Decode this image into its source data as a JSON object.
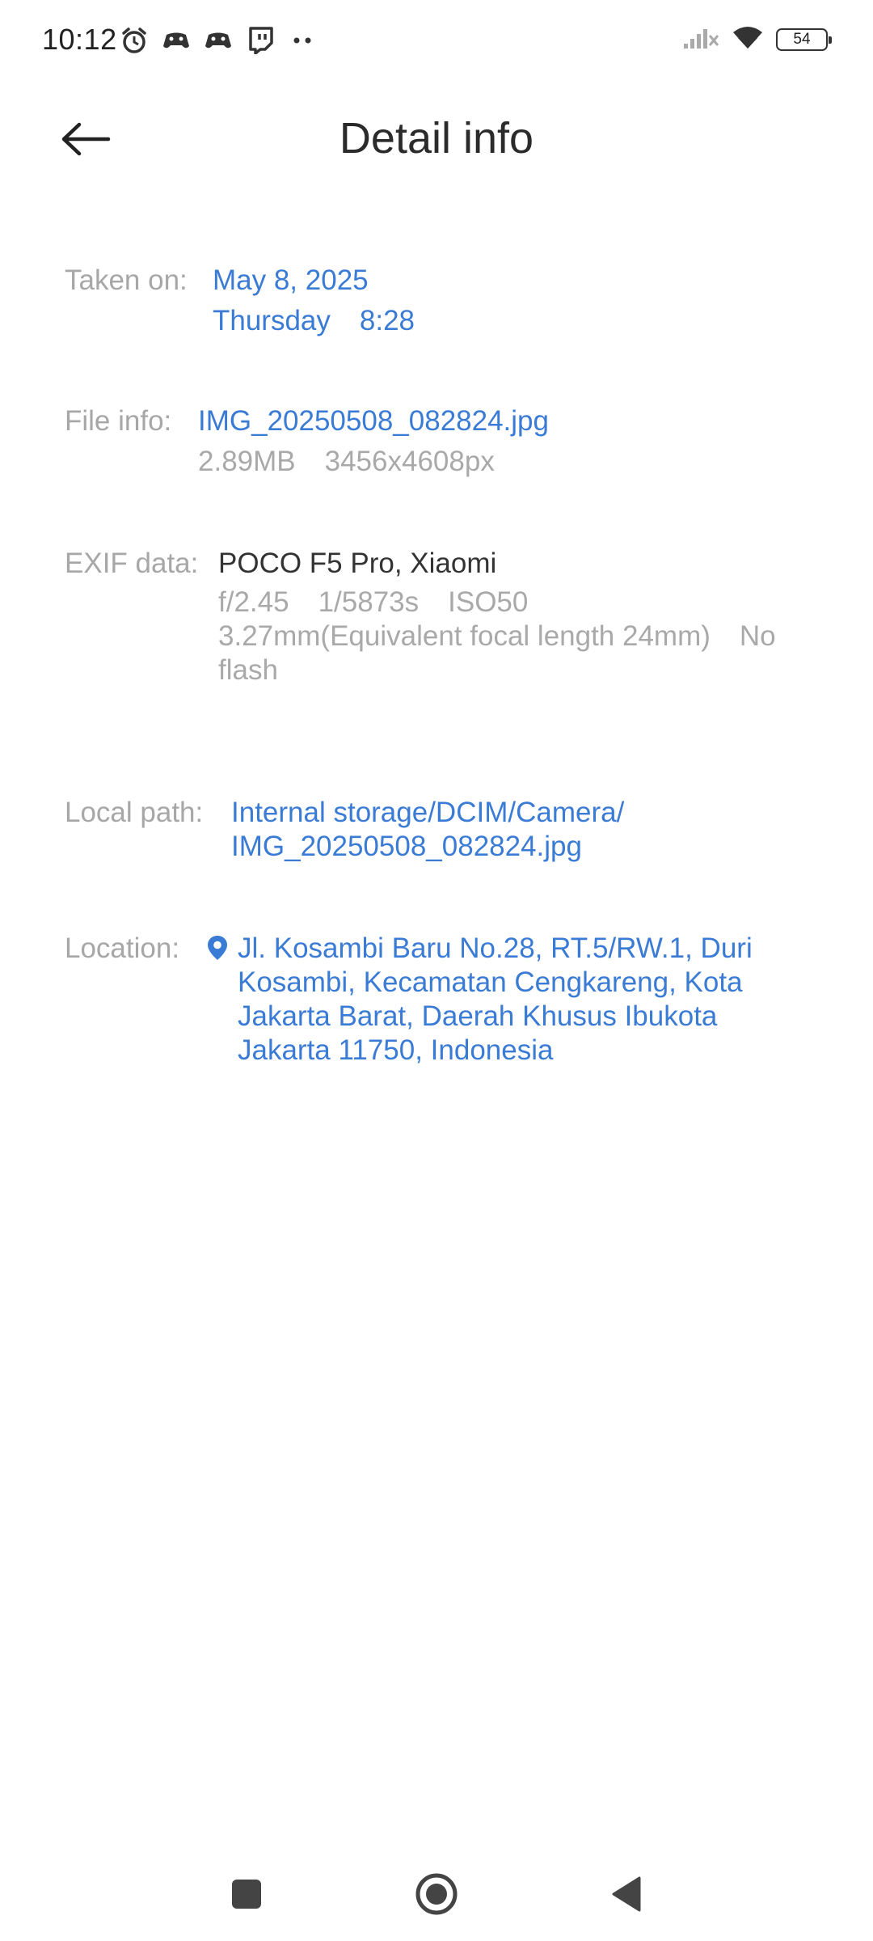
{
  "status_bar": {
    "time": "10:12",
    "battery": "54",
    "left_icons": [
      "alarm-icon",
      "game-controller-icon",
      "game-controller-icon",
      "twitch-icon",
      "more-dots-icon"
    ],
    "right_icons": [
      "signal-off-icon",
      "wifi-icon",
      "battery-icon"
    ]
  },
  "header": {
    "title": "Detail info",
    "back_icon": "back-arrow-icon"
  },
  "details": {
    "taken_on": {
      "label": "Taken on:",
      "date": "May 8, 2025",
      "day": "Thursday",
      "time": "8:28"
    },
    "file_info": {
      "label": "File info:",
      "filename": "IMG_20250508_082824.jpg",
      "size": "2.89MB",
      "resolution": "3456x4608px"
    },
    "exif": {
      "label": "EXIF data:",
      "device": "POCO F5 Pro, Xiaomi",
      "aperture": "f/2.45",
      "shutter": "1/5873s",
      "iso": "ISO50",
      "focal": "3.27mm(Equivalent focal length 24mm)",
      "flash_part1": "No",
      "flash_part2": "flash"
    },
    "local_path": {
      "label": "Local path:",
      "line1": "Internal storage/DCIM/Camera/",
      "line2": "IMG_20250508_082824.jpg"
    },
    "location": {
      "label": "Location:",
      "line1": "Jl. Kosambi Baru No.28, RT.5/RW.1, Duri",
      "line2": "Kosambi, Kecamatan Cengkareng, Kota",
      "line3": "Jakarta Barat, Daerah Khusus Ibukota",
      "line4": "Jakarta 11750, Indonesia"
    }
  },
  "nav_bar": {
    "icons": [
      "recents-square-icon",
      "home-circle-icon",
      "back-triangle-icon"
    ]
  },
  "colors": {
    "accent": "#3a7bd5",
    "label_gray": "#a7a7a7",
    "text_dark": "#333333"
  }
}
